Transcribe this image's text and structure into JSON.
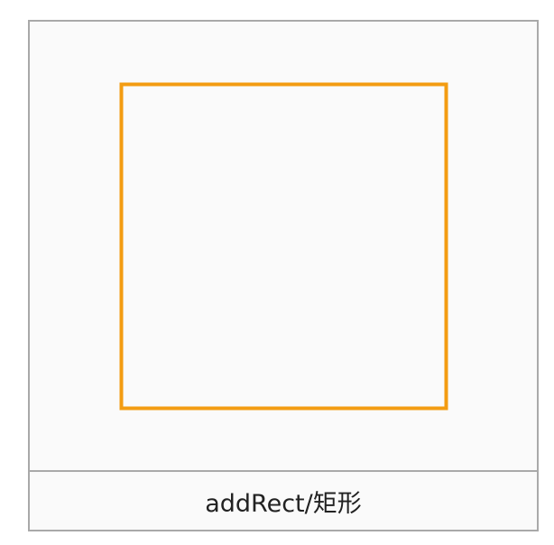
{
  "demo": {
    "caption": "addRect/矩形",
    "shape": "rectangle",
    "stroke_color": "#f39c12",
    "card_background": "#fafafa",
    "border_color": "#a9a9a9"
  }
}
